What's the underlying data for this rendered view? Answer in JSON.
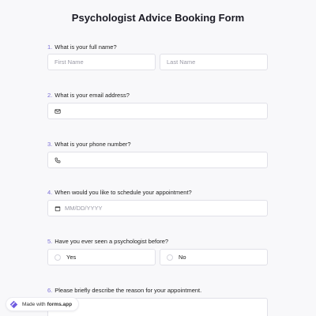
{
  "form": {
    "title": "Psychologist Advice Booking Form",
    "questions": [
      {
        "num": "1.",
        "label": "What is your full name?"
      },
      {
        "num": "2.",
        "label": "What is your email address?"
      },
      {
        "num": "3.",
        "label": "What is your phone number?"
      },
      {
        "num": "4.",
        "label": "When would you like to schedule your appointment?"
      },
      {
        "num": "5.",
        "label": "Have you ever seen a psychologist before?"
      },
      {
        "num": "6.",
        "label": "Please briefly describe the reason for your appointment."
      }
    ],
    "first_name_placeholder": "First Name",
    "last_name_placeholder": "Last Name",
    "email_value": "",
    "phone_value": "",
    "date_placeholder": "MM/DD/YYYY",
    "options": [
      "Yes",
      "No"
    ]
  },
  "badge": {
    "prefix": "Made with",
    "brand": "forms.app"
  },
  "colors": {
    "accent": "#7b6fd6",
    "background": "#f8f8fa",
    "field_border": "#e1e1e8"
  },
  "icons": [
    "envelope-icon",
    "phone-icon",
    "calendar-icon",
    "forms-app-logo-icon"
  ]
}
